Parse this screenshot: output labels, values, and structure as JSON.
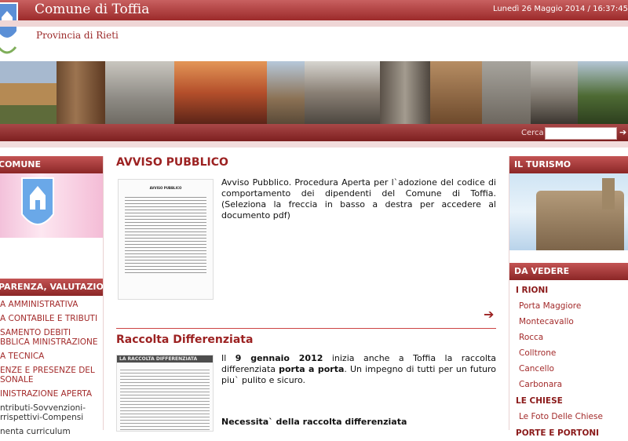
{
  "header": {
    "title": "Comune di Toffia",
    "date": "Lunedì 26 Maggio 2014 / 16:37:45",
    "province": "Provincia di Rieti"
  },
  "search": {
    "label": "Cerca",
    "placeholder": ""
  },
  "left": {
    "box_title": "COMUNE",
    "nav": [
      "PARENZA, VALUTAZIONE ERITO",
      "A AMMINISTRATIVA",
      "A CONTABILE E TRIBUTI",
      "SAMENTO DEBITI BBLICA MINISTRAZIONE",
      "A TECNICA",
      "ENZE E PRESENZE DEL SONALE",
      "INISTRAZIONE APERTA",
      "ntributi-Sovvenzioni-rrispettivi-Compensi",
      "nenta curriculum"
    ]
  },
  "main": {
    "avviso_title": "AVVISO PUBBLICO",
    "avviso_text": "Avviso Pubblico. Procedura Aperta per l`adozione del codice di comportamento dei dipendenti del Comune di Toffia. (Seleziona la freccia in basso a destra per accedere al documento pdf)",
    "avviso_arrow": "➔",
    "doc_heading": "AVVISO PUBBLICO",
    "raccolta_title": "Raccolta Differenziata",
    "raccolta_text_1": "Il ",
    "raccolta_date": "9 gennaio 2012",
    "raccolta_text_2": " inizia anche a Toffia la raccolta differenziata ",
    "raccolta_bold": "porta a porta",
    "raccolta_text_3": ". Un impegno di tutti per un futuro piu` pulito e sicuro.",
    "raccolta_thumb_label": "LA RACCOLTA DIFFERENZIATA",
    "necessita_title": "Necessita` della raccolta differenziata"
  },
  "right": {
    "turismo_title": "IL TURISMO",
    "vedere_title": "DA VEDERE",
    "sections": [
      {
        "cat": "I RIONI",
        "items": [
          "Porta Maggiore",
          "Montecavallo",
          "Rocca",
          "Colltrone",
          "Cancello",
          "Carbonara"
        ]
      },
      {
        "cat": "LE CHIESE",
        "items": [
          "Le Foto Delle Chiese"
        ]
      },
      {
        "cat": "PORTE E PORTONI",
        "items": []
      }
    ]
  },
  "colors": {
    "brand": "#9c2a2a",
    "link": "#a32b2b",
    "banner_top": "#c86060"
  }
}
